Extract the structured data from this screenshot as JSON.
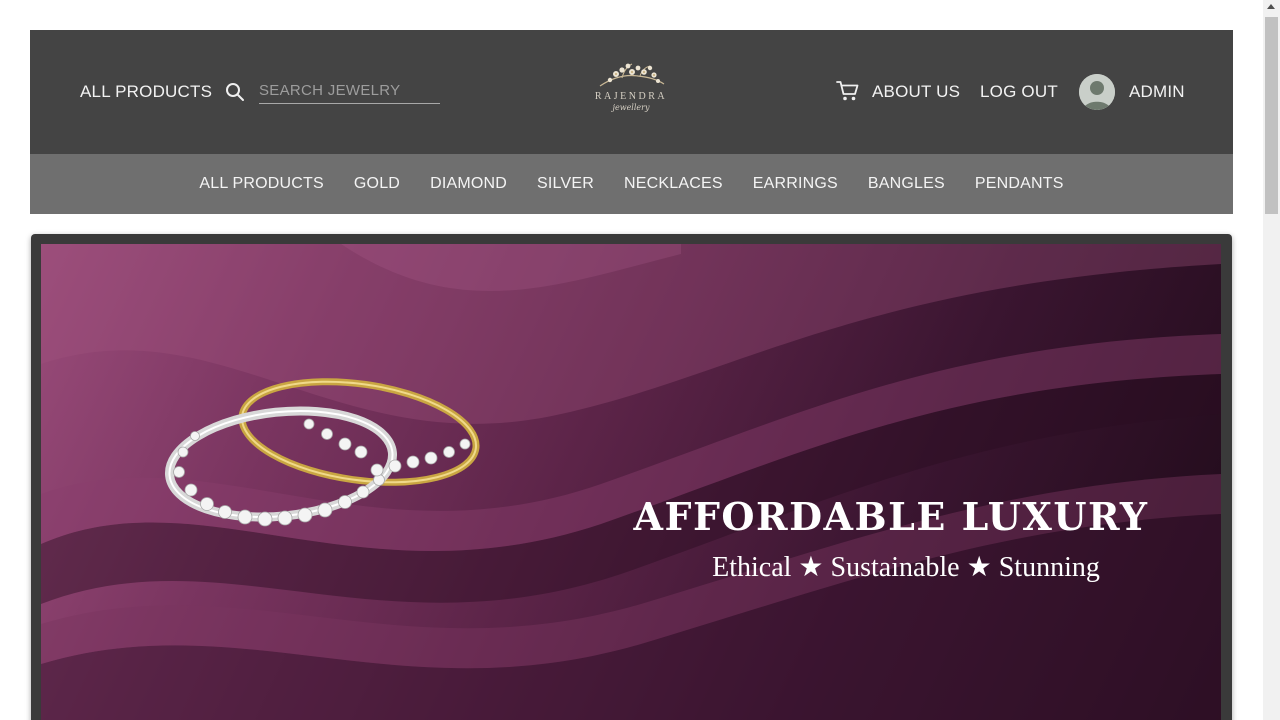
{
  "header": {
    "all_products_label": "ALL PRODUCTS",
    "search_placeholder": "SEARCH JEWELRY",
    "logo_name": "RAJENDRA",
    "logo_sub": "jewellery",
    "about_label": "ABOUT US",
    "logout_label": "LOG OUT",
    "user_label": "ADMIN"
  },
  "categories": [
    "ALL PRODUCTS",
    "GOLD",
    "DIAMOND",
    "SILVER",
    "NECKLACES",
    "EARRINGS",
    "BANGLES",
    "PENDANTS"
  ],
  "hero": {
    "title": "AFFORDABLE  LUXURY",
    "subtitle": "Ethical ★ Sustainable ★ Stunning"
  },
  "colors": {
    "header_bg": "#444444",
    "category_bar_bg": "#6f6f6f",
    "hero_accent": "#7a3560"
  }
}
